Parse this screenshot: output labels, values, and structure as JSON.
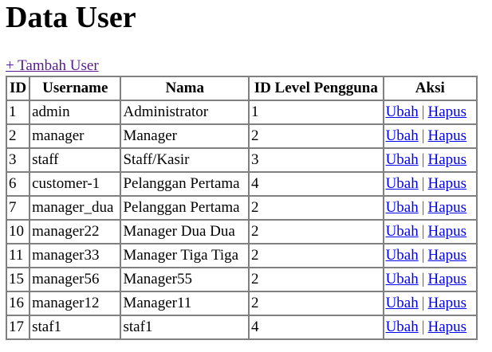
{
  "page": {
    "title": "Data User",
    "add_link": "+ Tambah User"
  },
  "table": {
    "headers": [
      "ID",
      "Username",
      "Nama",
      "ID Level Pengguna",
      "Aksi"
    ],
    "action_edit": "Ubah",
    "action_separator": "|",
    "action_delete": "Hapus",
    "rows": [
      {
        "id": "1",
        "username": "admin",
        "nama": "Administrator",
        "level": "1"
      },
      {
        "id": "2",
        "username": "manager",
        "nama": "Manager",
        "level": "2"
      },
      {
        "id": "3",
        "username": "staff",
        "nama": "Staff/Kasir",
        "level": "3"
      },
      {
        "id": "6",
        "username": "customer-1",
        "nama": "Pelanggan Pertama",
        "level": "4"
      },
      {
        "id": "7",
        "username": "manager_dua",
        "nama": "Pelanggan Pertama",
        "level": "2"
      },
      {
        "id": "10",
        "username": "manager22",
        "nama": "Manager Dua Dua",
        "level": "2"
      },
      {
        "id": "11",
        "username": "manager33",
        "nama": "Manager Tiga Tiga",
        "level": "2"
      },
      {
        "id": "15",
        "username": "manager56",
        "nama": "Manager55",
        "level": "2"
      },
      {
        "id": "16",
        "username": "manager12",
        "nama": "Manager11",
        "level": "2"
      },
      {
        "id": "17",
        "username": "staf1",
        "nama": "staf1",
        "level": "4"
      }
    ]
  },
  "colors": {
    "link_visited": "#551a8b",
    "link": "#0000ee",
    "border": "#808080"
  }
}
